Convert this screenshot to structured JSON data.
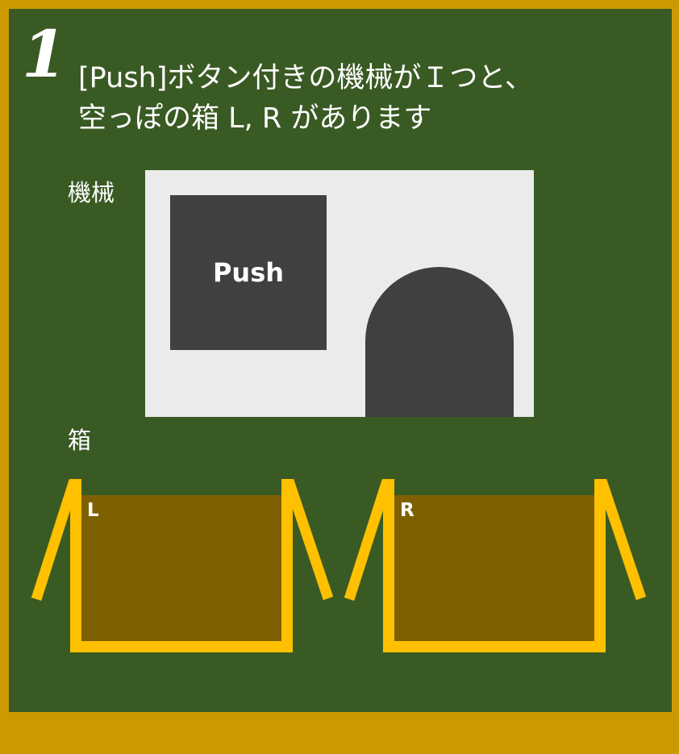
{
  "step": {
    "number": "1"
  },
  "title": {
    "line1": "[Push]ボタン付きの機械がＩつと、",
    "line2": "空っぽの箱 L, R があります"
  },
  "machine": {
    "label": "機械",
    "button_label": "Push"
  },
  "boxes": {
    "label": "箱",
    "items": [
      {
        "name": "L"
      },
      {
        "name": "R"
      }
    ]
  },
  "colors": {
    "frame": "#cc9900",
    "board": "#3a5a24",
    "machine_body": "#ebebeb",
    "machine_dark": "#404040",
    "box_outline": "#ffc000",
    "box_fill": "#7f6000",
    "text": "#ffffff"
  }
}
